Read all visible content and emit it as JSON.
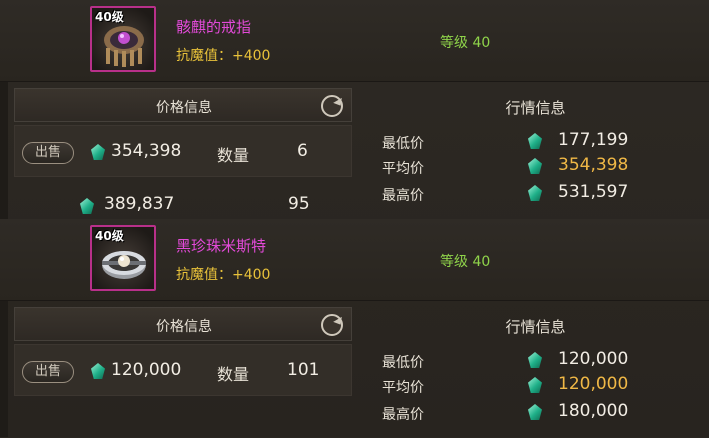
{
  "items": [
    {
      "level_badge": "40级",
      "name": "骸麒的戒指",
      "attr_label": "抗魔值：",
      "attr_value": "+400",
      "level_text": "等级 40",
      "price_header": "价格信息",
      "sell_button": "出售",
      "listing": {
        "price": "354,398",
        "qty_label": "数量",
        "qty": "6"
      },
      "extra_listing": {
        "price": "389,837",
        "qty": "95"
      },
      "market": {
        "title": "行情信息",
        "rows": [
          {
            "label": "最低价",
            "value": "177,199"
          },
          {
            "label": "平均价",
            "value": "354,398"
          },
          {
            "label": "最高价",
            "value": "531,597"
          }
        ]
      }
    },
    {
      "level_badge": "40级",
      "name": "黑珍珠米斯特",
      "attr_label": "抗魔值：",
      "attr_value": "+400",
      "level_text": "等级 40",
      "price_header": "价格信息",
      "sell_button": "出售",
      "listing": {
        "price": "120,000",
        "qty_label": "数量",
        "qty": "101"
      },
      "market": {
        "title": "行情信息",
        "rows": [
          {
            "label": "最低价",
            "value": "120,000"
          },
          {
            "label": "平均价",
            "value": "120,000"
          },
          {
            "label": "最高价",
            "value": "180,000"
          }
        ]
      }
    }
  ],
  "colors": {
    "item_name": "#e24ad8",
    "attr": "#e8c23a",
    "level": "#8fd44a",
    "avg_price": "#f0b846",
    "icon_border": "#b8308a"
  },
  "icons": [
    "crown-ring-icon",
    "pearl-ring-icon",
    "gem-currency-icon",
    "refresh-icon"
  ]
}
